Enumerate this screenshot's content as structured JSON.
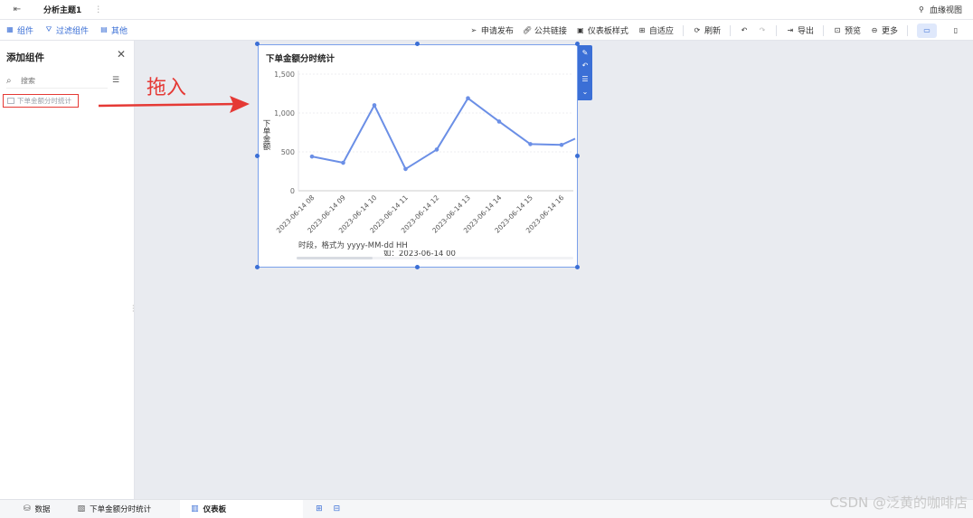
{
  "topbar": {
    "back_icon": "exit-icon",
    "title": "分析主题1",
    "more_icon": "more-vertical-icon",
    "lineage_label": "血缘视图"
  },
  "toolbar": {
    "left": [
      {
        "icon": "component-icon",
        "label": "组件"
      },
      {
        "icon": "filter-icon",
        "label": "过滤组件"
      },
      {
        "icon": "other-icon",
        "label": "其他"
      }
    ],
    "right": [
      {
        "icon": "send-icon",
        "label": "申请发布"
      },
      {
        "icon": "link-icon",
        "label": "公共链接"
      },
      {
        "icon": "style-icon",
        "label": "仪表板样式"
      },
      {
        "icon": "adapt-icon",
        "label": "自适应"
      },
      {
        "icon": "refresh-icon",
        "label": "刷新"
      },
      {
        "icon": "export-icon",
        "label": "导出"
      },
      {
        "icon": "preview-icon",
        "label": "预览"
      },
      {
        "icon": "more-icon",
        "label": "更多"
      }
    ]
  },
  "panel": {
    "title": "添加组件",
    "search_placeholder": "搜索",
    "component": "下单金额分时统计"
  },
  "annotation": {
    "text": "拖入",
    "color": "#e53935"
  },
  "widget": {
    "title": "下单金额分时统计",
    "tooltip_line1": "时段，格式为 yyyy-MM-dd HH",
    "tooltip_line2": "如：2023-06-14 00"
  },
  "chart_data": {
    "type": "line",
    "title": "下单金额分时统计",
    "ylabel": "下单金额",
    "xlabel": "",
    "ylim": [
      0,
      1500
    ],
    "yticks": [
      "0",
      "500",
      "1,000",
      "1,500"
    ],
    "categories": [
      "2023-06-14 08",
      "2023-06-14 09",
      "2023-06-14 10",
      "2023-06-14 11",
      "2023-06-14 12",
      "2023-06-14 13",
      "2023-06-14 14",
      "2023-06-14 15",
      "2023-06-14 16"
    ],
    "values": [
      440,
      360,
      1100,
      280,
      530,
      1190,
      890,
      600,
      590
    ],
    "trailing_value": 670,
    "color": "#6b8fe6",
    "grid": true
  },
  "bottombar": {
    "tabs": [
      {
        "icon": "database-icon",
        "label": "数据"
      },
      {
        "icon": "chart-icon",
        "label": "下单金额分时统计"
      },
      {
        "icon": "dashboard-icon",
        "label": "仪表板"
      }
    ]
  },
  "watermark": "CSDN @泛黄的咖啡店"
}
